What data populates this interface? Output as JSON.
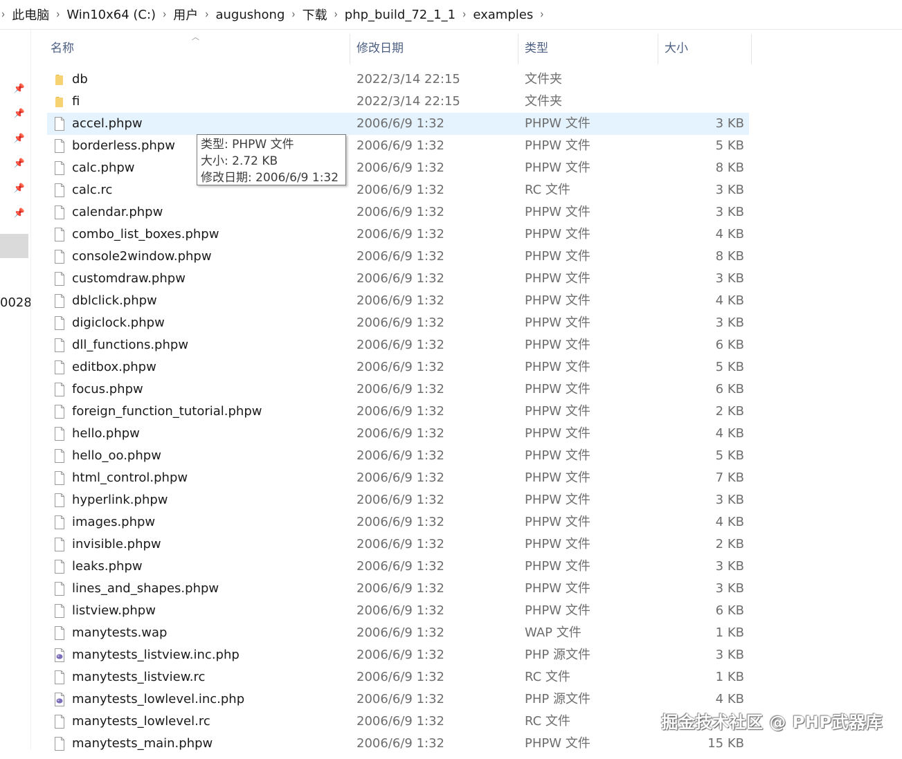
{
  "breadcrumb": [
    "此电脑",
    "Win10x64 (C:)",
    "用户",
    "augushong",
    "下载",
    "php_build_72_1_1",
    "examples"
  ],
  "nav": {
    "partial_label": "0028"
  },
  "columns": {
    "name": "名称",
    "date": "修改日期",
    "type": "类型",
    "size": "大小"
  },
  "selected_index": 2,
  "files": [
    {
      "name": "db",
      "date": "2022/3/14 22:15",
      "type": "文件夹",
      "size": "",
      "icon": "folder-icon"
    },
    {
      "name": "fi",
      "date": "2022/3/14 22:15",
      "type": "文件夹",
      "size": "",
      "icon": "folder-icon"
    },
    {
      "name": "accel.phpw",
      "date": "2006/6/9 1:32",
      "type": "PHPW 文件",
      "size": "3 KB",
      "icon": "file-icon"
    },
    {
      "name": "borderless.phpw",
      "date": "2006/6/9 1:32",
      "type": "PHPW 文件",
      "size": "5 KB",
      "icon": "file-icon"
    },
    {
      "name": "calc.phpw",
      "date": "2006/6/9 1:32",
      "type": "PHPW 文件",
      "size": "8 KB",
      "icon": "file-icon"
    },
    {
      "name": "calc.rc",
      "date": "2006/6/9 1:32",
      "type": "RC 文件",
      "size": "3 KB",
      "icon": "file-icon"
    },
    {
      "name": "calendar.phpw",
      "date": "2006/6/9 1:32",
      "type": "PHPW 文件",
      "size": "3 KB",
      "icon": "file-icon"
    },
    {
      "name": "combo_list_boxes.phpw",
      "date": "2006/6/9 1:32",
      "type": "PHPW 文件",
      "size": "4 KB",
      "icon": "file-icon"
    },
    {
      "name": "console2window.phpw",
      "date": "2006/6/9 1:32",
      "type": "PHPW 文件",
      "size": "8 KB",
      "icon": "file-icon"
    },
    {
      "name": "customdraw.phpw",
      "date": "2006/6/9 1:32",
      "type": "PHPW 文件",
      "size": "3 KB",
      "icon": "file-icon"
    },
    {
      "name": "dblclick.phpw",
      "date": "2006/6/9 1:32",
      "type": "PHPW 文件",
      "size": "4 KB",
      "icon": "file-icon"
    },
    {
      "name": "digiclock.phpw",
      "date": "2006/6/9 1:32",
      "type": "PHPW 文件",
      "size": "3 KB",
      "icon": "file-icon"
    },
    {
      "name": "dll_functions.phpw",
      "date": "2006/6/9 1:32",
      "type": "PHPW 文件",
      "size": "6 KB",
      "icon": "file-icon"
    },
    {
      "name": "editbox.phpw",
      "date": "2006/6/9 1:32",
      "type": "PHPW 文件",
      "size": "5 KB",
      "icon": "file-icon"
    },
    {
      "name": "focus.phpw",
      "date": "2006/6/9 1:32",
      "type": "PHPW 文件",
      "size": "6 KB",
      "icon": "file-icon"
    },
    {
      "name": "foreign_function_tutorial.phpw",
      "date": "2006/6/9 1:32",
      "type": "PHPW 文件",
      "size": "2 KB",
      "icon": "file-icon"
    },
    {
      "name": "hello.phpw",
      "date": "2006/6/9 1:32",
      "type": "PHPW 文件",
      "size": "4 KB",
      "icon": "file-icon"
    },
    {
      "name": "hello_oo.phpw",
      "date": "2006/6/9 1:32",
      "type": "PHPW 文件",
      "size": "5 KB",
      "icon": "file-icon"
    },
    {
      "name": "html_control.phpw",
      "date": "2006/6/9 1:32",
      "type": "PHPW 文件",
      "size": "7 KB",
      "icon": "file-icon"
    },
    {
      "name": "hyperlink.phpw",
      "date": "2006/6/9 1:32",
      "type": "PHPW 文件",
      "size": "3 KB",
      "icon": "file-icon"
    },
    {
      "name": "images.phpw",
      "date": "2006/6/9 1:32",
      "type": "PHPW 文件",
      "size": "4 KB",
      "icon": "file-icon"
    },
    {
      "name": "invisible.phpw",
      "date": "2006/6/9 1:32",
      "type": "PHPW 文件",
      "size": "2 KB",
      "icon": "file-icon"
    },
    {
      "name": "leaks.phpw",
      "date": "2006/6/9 1:32",
      "type": "PHPW 文件",
      "size": "3 KB",
      "icon": "file-icon"
    },
    {
      "name": "lines_and_shapes.phpw",
      "date": "2006/6/9 1:32",
      "type": "PHPW 文件",
      "size": "3 KB",
      "icon": "file-icon"
    },
    {
      "name": "listview.phpw",
      "date": "2006/6/9 1:32",
      "type": "PHPW 文件",
      "size": "6 KB",
      "icon": "file-icon"
    },
    {
      "name": "manytests.wap",
      "date": "2006/6/9 1:32",
      "type": "WAP 文件",
      "size": "1 KB",
      "icon": "file-icon"
    },
    {
      "name": "manytests_listview.inc.php",
      "date": "2006/6/9 1:32",
      "type": "PHP 源文件",
      "size": "3 KB",
      "icon": "php-file-icon"
    },
    {
      "name": "manytests_listview.rc",
      "date": "2006/6/9 1:32",
      "type": "RC 文件",
      "size": "1 KB",
      "icon": "file-icon"
    },
    {
      "name": "manytests_lowlevel.inc.php",
      "date": "2006/6/9 1:32",
      "type": "PHP 源文件",
      "size": "4 KB",
      "icon": "php-file-icon"
    },
    {
      "name": "manytests_lowlevel.rc",
      "date": "2006/6/9 1:32",
      "type": "RC 文件",
      "size": "",
      "icon": "file-icon"
    },
    {
      "name": "manytests_main.phpw",
      "date": "2006/6/9 1:32",
      "type": "PHPW 文件",
      "size": "15 KB",
      "icon": "file-icon"
    }
  ],
  "tooltip": {
    "line1": "类型: PHPW 文件",
    "line2": "大小: 2.72 KB",
    "line3": "修改日期: 2006/6/9 1:32"
  },
  "watermark": "掘金技术社区 @ PHP武器库",
  "colors": {
    "selected_row": "#e5f3ff",
    "header_text": "#4d6082",
    "folder": "#f2c55c"
  }
}
